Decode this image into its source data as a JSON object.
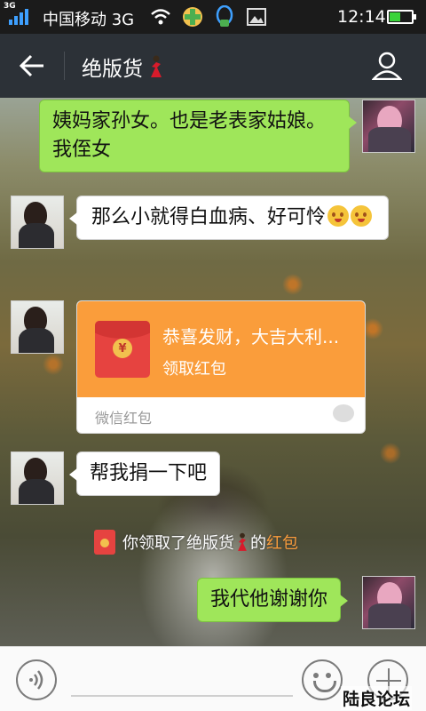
{
  "status_bar": {
    "sim_label": "3G",
    "carrier": "中国移动 3G",
    "time": "12:14",
    "icons": [
      "signal-icon",
      "wifi-icon",
      "app-notification-icon",
      "qq-notification-icon",
      "image-notification-icon",
      "battery-icon"
    ],
    "battery_level": 0.5
  },
  "header": {
    "title": "绝版货",
    "title_emoji": "dancer-emoji-icon"
  },
  "messages": [
    {
      "direction": "out",
      "text": "姨妈家孙女。也是老表家姑娘。我侄女"
    },
    {
      "direction": "in",
      "text": "那么小就得白血病、好可怜",
      "emoji_count": 2
    },
    {
      "direction": "in",
      "type": "red_packet",
      "greeting": "恭喜发财，大吉大利...",
      "action": "领取红包",
      "footer": "微信红包"
    },
    {
      "direction": "in",
      "text": "帮我捐一下吧"
    },
    {
      "direction": "out",
      "text": "我代他谢谢你"
    }
  ],
  "system_notice": {
    "prefix": "你领取了绝版货",
    "suffix": "的",
    "link": "红包"
  },
  "input_bar": {
    "voice_icon": "voice-icon",
    "emoji_icon": "emoji-icon",
    "plus_icon": "plus-icon"
  },
  "watermark": "陆良论坛",
  "colors": {
    "bubble_out": "#9fe65a",
    "red_packet": "#fa9d3b",
    "title_bar": "#2c3137"
  }
}
